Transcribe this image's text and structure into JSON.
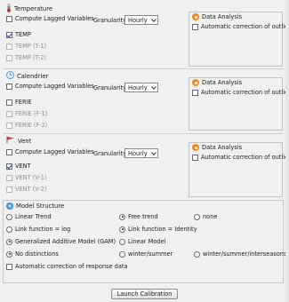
{
  "common": {
    "compute_lagged": "Compute Lagged Variables",
    "granularity_label": "Granularity:",
    "granularity_value": "Hourly",
    "data_analysis_title": "Data Analysis",
    "auto_correction_outliers": "Automatic correction of outliers"
  },
  "temperature": {
    "title": "Temperature",
    "var": "TEMP",
    "lag1": "TEMP (T-1)",
    "lag2": "TEMP (T-2)"
  },
  "calendrier": {
    "title": "Calendrier",
    "var": "FERIE",
    "lag1": "FERIE (F-1)",
    "lag2": "FERIE (F-2)"
  },
  "vent": {
    "title": "Vent",
    "var": "VENT",
    "lag1": "VENT (V-1)",
    "lag2": "VENT (V-2)"
  },
  "model": {
    "title": "Model Structure",
    "linear_trend": "Linear Trend",
    "free_trend": "Free trend",
    "none": "none",
    "link_log": "Link function = log",
    "link_identity": "Link function = Identity",
    "gam": "Generalized Additive Model (GAM)",
    "linear_model": "Linear Model",
    "no_distinctions": "No distinctions",
    "winter_summer": "winter/summer",
    "winter_summer_inter": "winter/summer/interseasons",
    "auto_correction_response": "Automatic correction of response data"
  },
  "launch_label": "Launch Calibration",
  "colors": {
    "accent_blue": "#3a8fd9",
    "gear_orange": "#f08a24",
    "flag_red": "#d43030"
  }
}
